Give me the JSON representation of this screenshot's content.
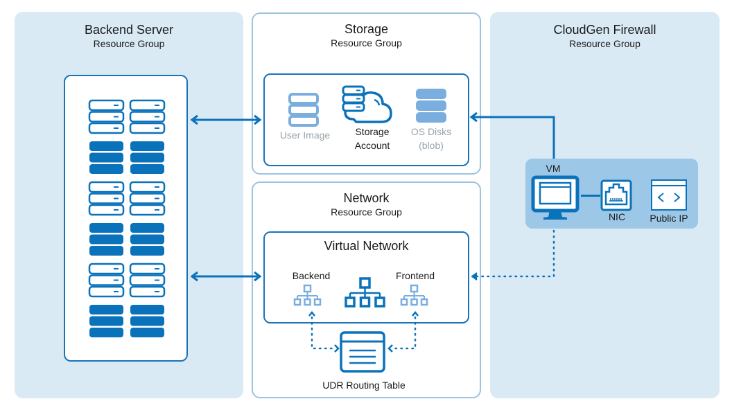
{
  "colors": {
    "primary": "#0a72bb",
    "light_icon": "#7aaede",
    "group_bg": "#daeaf4",
    "vm_panel_bg": "#9dc7e6",
    "group_border": "#9cc3e0"
  },
  "groups": {
    "backend": {
      "title": "Backend Server",
      "subtitle": "Resource Group"
    },
    "storage": {
      "title": "Storage",
      "subtitle": "Resource Group"
    },
    "network": {
      "title": "Network",
      "subtitle": "Resource Group"
    },
    "firewall": {
      "title": "CloudGen Firewall",
      "subtitle": "Resource Group"
    }
  },
  "storage": {
    "items": [
      {
        "label_line1": "User Image",
        "label_line2": "",
        "icon": "database-icon",
        "muted": true
      },
      {
        "label_line1": "Storage",
        "label_line2": "Account",
        "icon": "storage-cloud-icon",
        "muted": false
      },
      {
        "label_line1": "OS Disks",
        "label_line2": "(blob)",
        "icon": "disk-stack-icon",
        "muted": true
      }
    ]
  },
  "network": {
    "vnet_title": "Virtual Network",
    "subnets": [
      {
        "label": "Backend",
        "icon": "subnet-icon"
      },
      {
        "label": "Frontend",
        "icon": "subnet-icon"
      }
    ],
    "udr_label": "UDR Routing Table"
  },
  "firewall": {
    "vm_label": "VM",
    "nic_label": "NIC",
    "public_ip_label": "Public IP"
  }
}
